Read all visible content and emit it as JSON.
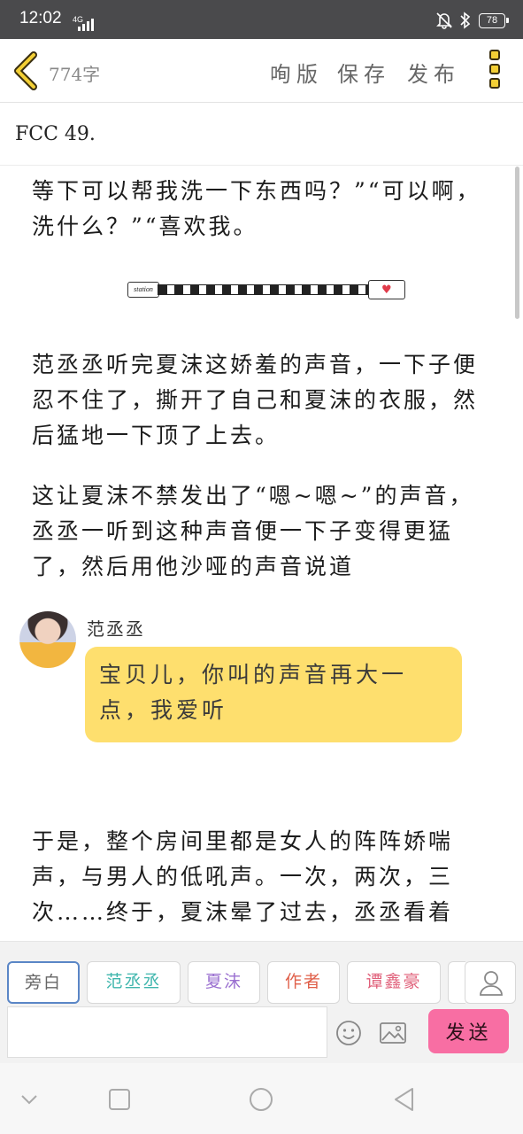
{
  "status_bar": {
    "time": "12:02",
    "network": "4G",
    "battery": "78",
    "icons": [
      "muted-bell-icon",
      "bluetooth-icon",
      "battery-icon"
    ]
  },
  "toolbar": {
    "word_count": "774字",
    "typeset_label": "咰版",
    "save_label": "保存",
    "publish_label": "发布",
    "icons": [
      "back-chevron-icon",
      "menu-dots-icon"
    ]
  },
  "title": "FCC 49.",
  "content": {
    "para1": "等下可以帮我洗一下东西吗？”“可以啊，洗什么？”“喜欢我。",
    "divider_tag": "station",
    "para2": "范丞丞听完夏沫这娇羞的声音，一下子便忍不住了，撕开了自己和夏沫的衣服，然后猛地一下顶了上去。",
    "para3": "这让夏沫不禁发出了“嗯~嗯~”的声音，丞丞一听到这种声音便一下子变得更猛了，然后用他沙哑的声音说道",
    "speaker_name": "范丞丞",
    "bubble_text": "宝贝儿，你叫的声音再大一点，我爱听",
    "para4": "于是，整个房间里都是女人的阵阵娇喘声，与男人的低吼声。一次，两次，三次……终于，夏沫晕了过去，丞丞看着"
  },
  "roles": {
    "items": [
      {
        "label": "旁白",
        "color": "#666666"
      },
      {
        "label": "范丞丞",
        "color": "#3fb6ad"
      },
      {
        "label": "夏沫",
        "color": "#9a6fd0"
      },
      {
        "label": "作者",
        "color": "#e0604a"
      },
      {
        "label": "谭鑫豪",
        "color": "#e0607a"
      }
    ],
    "send_label": "发送",
    "input_value": "",
    "icons": [
      "person-icon",
      "emoji-icon",
      "image-icon"
    ]
  },
  "nav_bar": {
    "icons": [
      "chevron-down-icon",
      "recent-apps-icon",
      "home-icon",
      "back-icon"
    ]
  }
}
